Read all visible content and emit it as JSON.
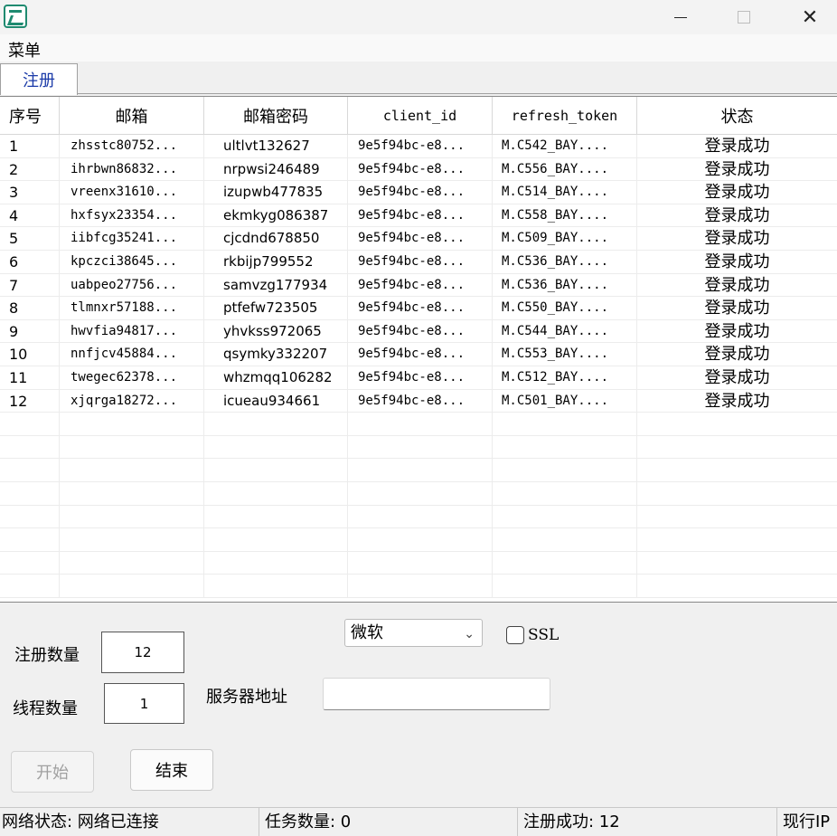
{
  "window": {
    "controls": {
      "minimize_icon": "minimize-icon",
      "maximize_icon": "maximize-icon",
      "close_icon": "close-icon",
      "close_glyph": "✕"
    }
  },
  "menu": {
    "items": [
      "菜单"
    ]
  },
  "tabs": [
    {
      "label": "注册",
      "active": true
    }
  ],
  "table": {
    "columns": [
      "序号",
      "邮箱",
      "邮箱密码",
      "client_id",
      "refresh_token",
      "状态"
    ],
    "rows": [
      [
        "1",
        "zhsstc80752...",
        "ultlvt132627",
        "9e5f94bc-e8...",
        "M.C542_BAY....",
        "登录成功"
      ],
      [
        "2",
        "ihrbwn86832...",
        "nrpwsi246489",
        "9e5f94bc-e8...",
        "M.C556_BAY....",
        "登录成功"
      ],
      [
        "3",
        "vreenx31610...",
        "izupwb477835",
        "9e5f94bc-e8...",
        "M.C514_BAY....",
        "登录成功"
      ],
      [
        "4",
        "hxfsyx23354...",
        "ekmkyg086387",
        "9e5f94bc-e8...",
        "M.C558_BAY....",
        "登录成功"
      ],
      [
        "5",
        "iibfcg35241...",
        "cjcdnd678850",
        "9e5f94bc-e8...",
        "M.C509_BAY....",
        "登录成功"
      ],
      [
        "6",
        "kpczci38645...",
        "rkbijp799552",
        "9e5f94bc-e8...",
        "M.C536_BAY....",
        "登录成功"
      ],
      [
        "7",
        "uabpeo27756...",
        "samvzg177934",
        "9e5f94bc-e8...",
        "M.C536_BAY....",
        "登录成功"
      ],
      [
        "8",
        "tlmnxr57188...",
        "ptfefw723505",
        "9e5f94bc-e8...",
        "M.C550_BAY....",
        "登录成功"
      ],
      [
        "9",
        "hwvfia94817...",
        "yhvkss972065",
        "9e5f94bc-e8...",
        "M.C544_BAY....",
        "登录成功"
      ],
      [
        "10",
        "nnfjcv45884...",
        "qsymky332207",
        "9e5f94bc-e8...",
        "M.C553_BAY....",
        "登录成功"
      ],
      [
        "11",
        "twegec62378...",
        "whzmqq106282",
        "9e5f94bc-e8...",
        "M.C512_BAY....",
        "登录成功"
      ],
      [
        "12",
        "xjqrga18272...",
        "icueau934661",
        "9e5f94bc-e8...",
        "M.C501_BAY....",
        "登录成功"
      ]
    ]
  },
  "form": {
    "register_count_label": "注册数量",
    "register_count_value": "12",
    "thread_count_label": "线程数量",
    "thread_count_value": "1",
    "provider_selected": "微软",
    "ssl_label": "SSL",
    "ssl_checked": false,
    "server_label": "服务器地址",
    "server_value": "",
    "start_label": "开始",
    "stop_label": "结束"
  },
  "status": {
    "network": "网络状态: 网络已连接",
    "tasks": "任务数量: 0",
    "success": "注册成功: 12",
    "ip": "现行IP"
  },
  "colors": {
    "tab_text": "#1a3aa8",
    "app_icon": "#1f8a70"
  }
}
